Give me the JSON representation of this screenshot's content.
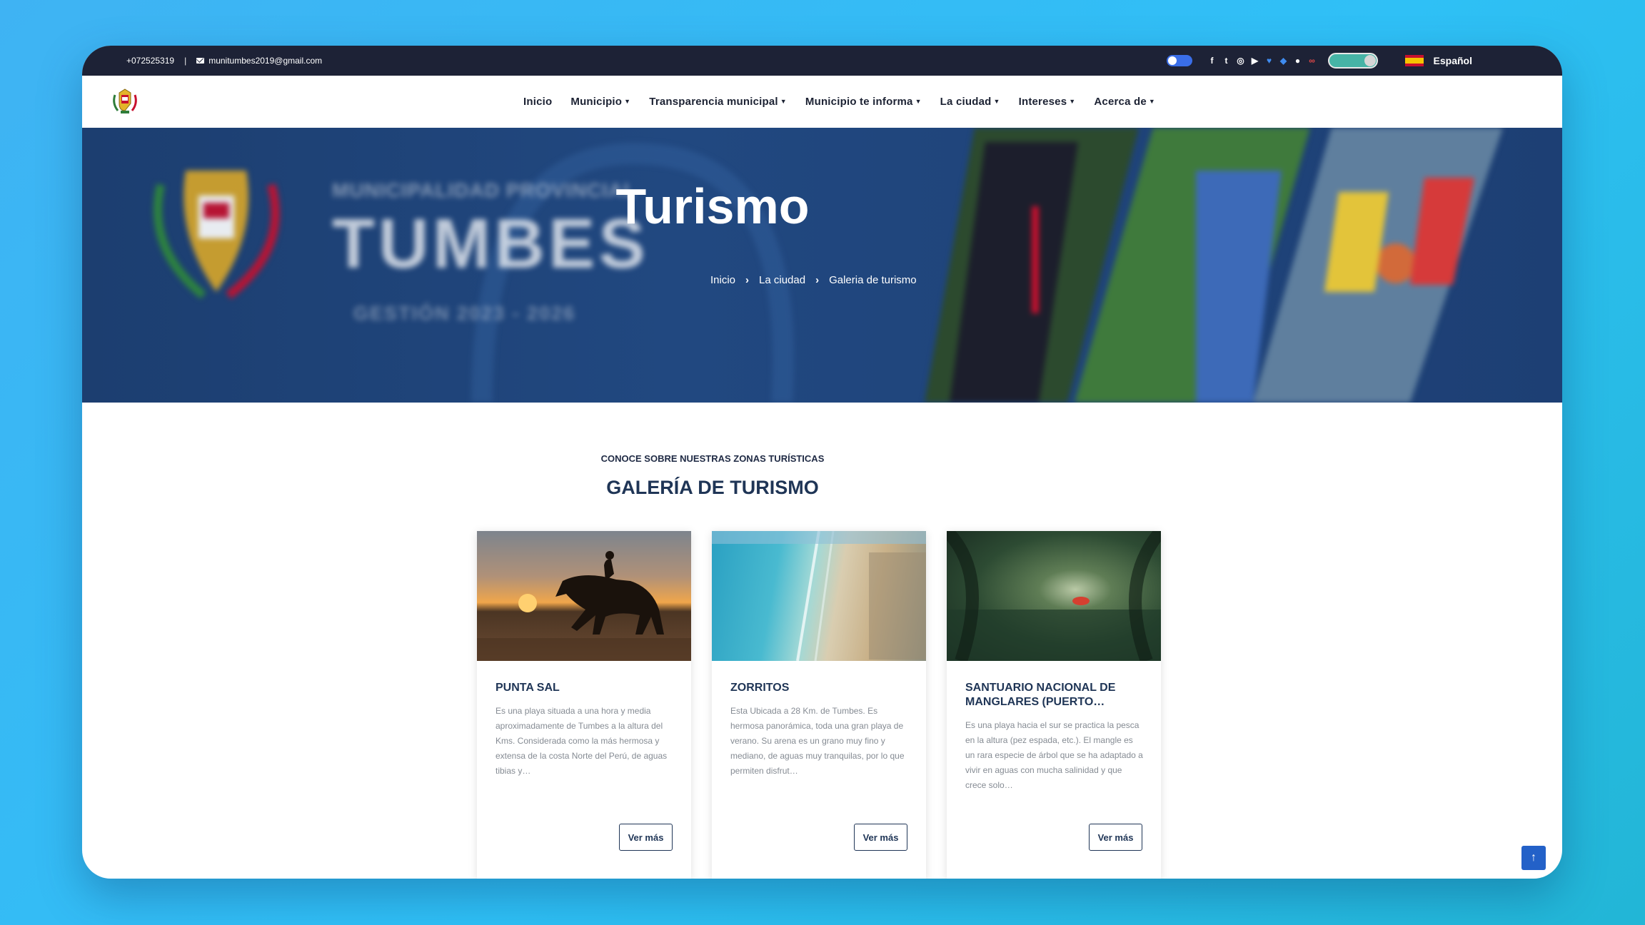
{
  "topbar": {
    "phone": "+072525319",
    "separator": "|",
    "email": "munitumbes2019@gmail.com",
    "social_icons": [
      "facebook-icon",
      "twitter-icon",
      "instagram-icon",
      "youtube-icon",
      "bluesky-icon",
      "chat-icon",
      "badge-icon",
      "link-icon"
    ],
    "language": "Español"
  },
  "nav": {
    "items": [
      {
        "label": "Inicio",
        "dropdown": false
      },
      {
        "label": "Municipio",
        "dropdown": true
      },
      {
        "label": "Transparencia municipal",
        "dropdown": true
      },
      {
        "label": "Municipio te informa",
        "dropdown": true
      },
      {
        "label": "La ciudad",
        "dropdown": true
      },
      {
        "label": "Intereses",
        "dropdown": true
      },
      {
        "label": "Acerca de",
        "dropdown": true
      }
    ]
  },
  "hero": {
    "brand_sub": "MUNICIPALIDAD PROVINCIAL",
    "brand_main": "TUMBES",
    "brand_period": "GESTIÓN 2023 - 2026",
    "title": "Turismo",
    "breadcrumb": [
      "Inicio",
      "La ciudad",
      "Galeria de turismo"
    ]
  },
  "section": {
    "eyebrow": "CONOCE SOBRE NUESTRAS ZONAS TURÍSTICAS",
    "heading": "GALERÍA DE TURISMO"
  },
  "cards": [
    {
      "title": "PUNTA SAL",
      "text": "Es una playa situada a una hora y media aproximadamente de Tumbes a la altura del Kms. Considerada como la más hermosa y extensa de la costa Norte del Perú, de aguas tibias y…",
      "button": "Ver más"
    },
    {
      "title": "ZORRITOS",
      "text": "Esta Ubicada a 28 Km. de Tumbes. Es hermosa panorámica, toda una gran playa de verano. Su arena es un grano muy fino y mediano, de aguas muy tranquilas, por lo que permiten disfrut…",
      "button": "Ver más"
    },
    {
      "title": "SANTUARIO NACIONAL DE MANGLARES (PUERTO…",
      "text": "Es una playa hacia el sur se practica la pesca en la altura (pez espada, etc.). El mangle es un rara especie de árbol que se ha adaptado a vivir en aguas con mucha salinidad y que crece solo…",
      "button": "Ver más"
    }
  ],
  "colors": {
    "topbar": "#1d2236",
    "hero": "#214880",
    "heading": "#1f3556",
    "accent": "#2361c8"
  }
}
